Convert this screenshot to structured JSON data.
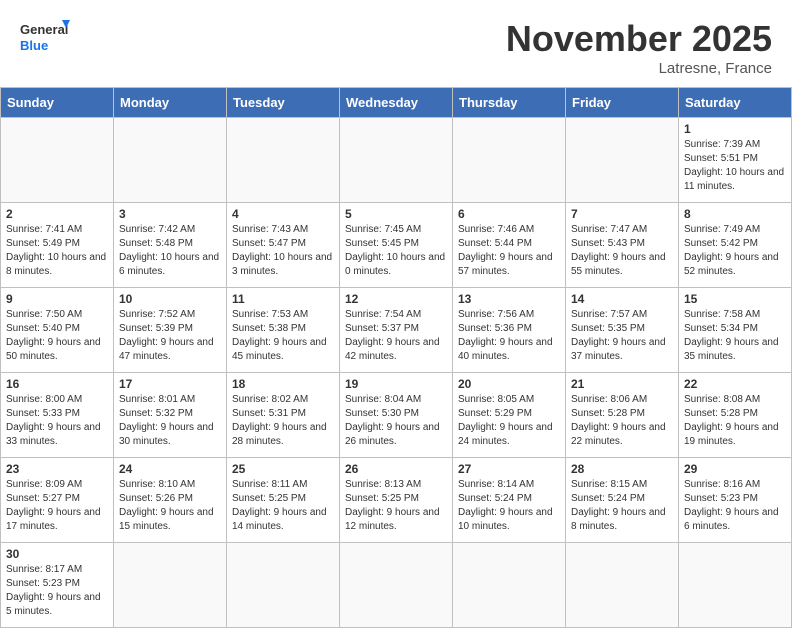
{
  "header": {
    "logo_general": "General",
    "logo_blue": "Blue",
    "month_year": "November 2025",
    "location": "Latresne, France"
  },
  "days_of_week": [
    "Sunday",
    "Monday",
    "Tuesday",
    "Wednesday",
    "Thursday",
    "Friday",
    "Saturday"
  ],
  "weeks": [
    [
      {
        "day": "",
        "info": ""
      },
      {
        "day": "",
        "info": ""
      },
      {
        "day": "",
        "info": ""
      },
      {
        "day": "",
        "info": ""
      },
      {
        "day": "",
        "info": ""
      },
      {
        "day": "",
        "info": ""
      },
      {
        "day": "1",
        "info": "Sunrise: 7:39 AM\nSunset: 5:51 PM\nDaylight: 10 hours and 11 minutes."
      }
    ],
    [
      {
        "day": "2",
        "info": "Sunrise: 7:41 AM\nSunset: 5:49 PM\nDaylight: 10 hours and 8 minutes."
      },
      {
        "day": "3",
        "info": "Sunrise: 7:42 AM\nSunset: 5:48 PM\nDaylight: 10 hours and 6 minutes."
      },
      {
        "day": "4",
        "info": "Sunrise: 7:43 AM\nSunset: 5:47 PM\nDaylight: 10 hours and 3 minutes."
      },
      {
        "day": "5",
        "info": "Sunrise: 7:45 AM\nSunset: 5:45 PM\nDaylight: 10 hours and 0 minutes."
      },
      {
        "day": "6",
        "info": "Sunrise: 7:46 AM\nSunset: 5:44 PM\nDaylight: 9 hours and 57 minutes."
      },
      {
        "day": "7",
        "info": "Sunrise: 7:47 AM\nSunset: 5:43 PM\nDaylight: 9 hours and 55 minutes."
      },
      {
        "day": "8",
        "info": "Sunrise: 7:49 AM\nSunset: 5:42 PM\nDaylight: 9 hours and 52 minutes."
      }
    ],
    [
      {
        "day": "9",
        "info": "Sunrise: 7:50 AM\nSunset: 5:40 PM\nDaylight: 9 hours and 50 minutes."
      },
      {
        "day": "10",
        "info": "Sunrise: 7:52 AM\nSunset: 5:39 PM\nDaylight: 9 hours and 47 minutes."
      },
      {
        "day": "11",
        "info": "Sunrise: 7:53 AM\nSunset: 5:38 PM\nDaylight: 9 hours and 45 minutes."
      },
      {
        "day": "12",
        "info": "Sunrise: 7:54 AM\nSunset: 5:37 PM\nDaylight: 9 hours and 42 minutes."
      },
      {
        "day": "13",
        "info": "Sunrise: 7:56 AM\nSunset: 5:36 PM\nDaylight: 9 hours and 40 minutes."
      },
      {
        "day": "14",
        "info": "Sunrise: 7:57 AM\nSunset: 5:35 PM\nDaylight: 9 hours and 37 minutes."
      },
      {
        "day": "15",
        "info": "Sunrise: 7:58 AM\nSunset: 5:34 PM\nDaylight: 9 hours and 35 minutes."
      }
    ],
    [
      {
        "day": "16",
        "info": "Sunrise: 8:00 AM\nSunset: 5:33 PM\nDaylight: 9 hours and 33 minutes."
      },
      {
        "day": "17",
        "info": "Sunrise: 8:01 AM\nSunset: 5:32 PM\nDaylight: 9 hours and 30 minutes."
      },
      {
        "day": "18",
        "info": "Sunrise: 8:02 AM\nSunset: 5:31 PM\nDaylight: 9 hours and 28 minutes."
      },
      {
        "day": "19",
        "info": "Sunrise: 8:04 AM\nSunset: 5:30 PM\nDaylight: 9 hours and 26 minutes."
      },
      {
        "day": "20",
        "info": "Sunrise: 8:05 AM\nSunset: 5:29 PM\nDaylight: 9 hours and 24 minutes."
      },
      {
        "day": "21",
        "info": "Sunrise: 8:06 AM\nSunset: 5:28 PM\nDaylight: 9 hours and 22 minutes."
      },
      {
        "day": "22",
        "info": "Sunrise: 8:08 AM\nSunset: 5:28 PM\nDaylight: 9 hours and 19 minutes."
      }
    ],
    [
      {
        "day": "23",
        "info": "Sunrise: 8:09 AM\nSunset: 5:27 PM\nDaylight: 9 hours and 17 minutes."
      },
      {
        "day": "24",
        "info": "Sunrise: 8:10 AM\nSunset: 5:26 PM\nDaylight: 9 hours and 15 minutes."
      },
      {
        "day": "25",
        "info": "Sunrise: 8:11 AM\nSunset: 5:25 PM\nDaylight: 9 hours and 14 minutes."
      },
      {
        "day": "26",
        "info": "Sunrise: 8:13 AM\nSunset: 5:25 PM\nDaylight: 9 hours and 12 minutes."
      },
      {
        "day": "27",
        "info": "Sunrise: 8:14 AM\nSunset: 5:24 PM\nDaylight: 9 hours and 10 minutes."
      },
      {
        "day": "28",
        "info": "Sunrise: 8:15 AM\nSunset: 5:24 PM\nDaylight: 9 hours and 8 minutes."
      },
      {
        "day": "29",
        "info": "Sunrise: 8:16 AM\nSunset: 5:23 PM\nDaylight: 9 hours and 6 minutes."
      }
    ],
    [
      {
        "day": "30",
        "info": "Sunrise: 8:17 AM\nSunset: 5:23 PM\nDaylight: 9 hours and 5 minutes."
      },
      {
        "day": "",
        "info": ""
      },
      {
        "day": "",
        "info": ""
      },
      {
        "day": "",
        "info": ""
      },
      {
        "day": "",
        "info": ""
      },
      {
        "day": "",
        "info": ""
      },
      {
        "day": "",
        "info": ""
      }
    ]
  ]
}
